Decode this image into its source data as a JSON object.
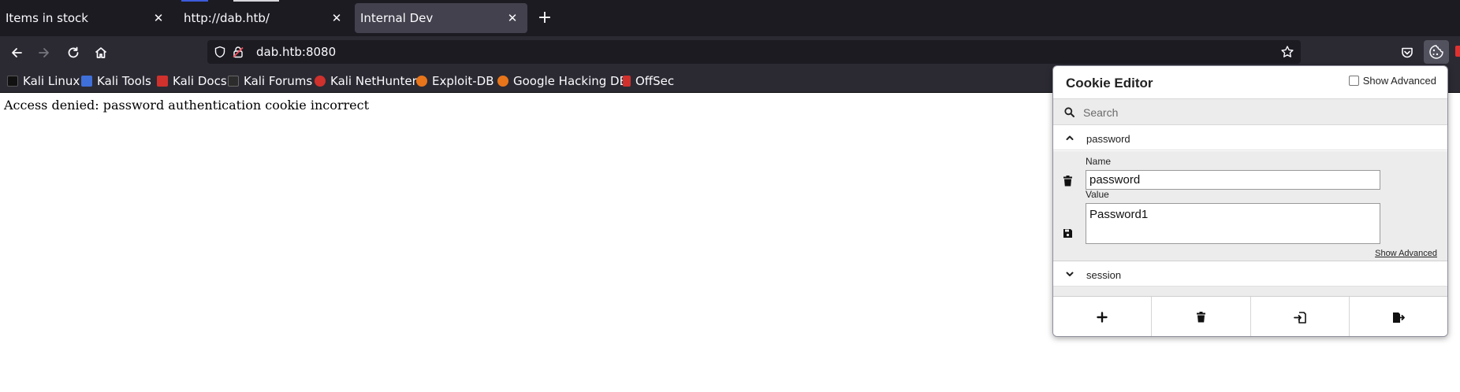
{
  "tabs": [
    {
      "title": "Items in stock",
      "active": false
    },
    {
      "title": "http://dab.htb/",
      "active": false
    },
    {
      "title": "Internal Dev",
      "active": true
    }
  ],
  "navbar": {
    "url": "dab.htb:8080"
  },
  "bookmarks": [
    {
      "label": "Kali Linux",
      "icon": "kali-linux-icon",
      "color": "#2c2c2c"
    },
    {
      "label": "Kali Tools",
      "icon": "kali-tools-icon",
      "color": "#3f6fd8"
    },
    {
      "label": "Kali Docs",
      "icon": "kali-docs-icon",
      "color": "#d0312d"
    },
    {
      "label": "Kali Forums",
      "icon": "kali-forums-icon",
      "color": "#2c2c2c"
    },
    {
      "label": "Kali NetHunter",
      "icon": "kali-nethunter-icon",
      "color": "#d0312d"
    },
    {
      "label": "Exploit-DB",
      "icon": "exploit-db-icon",
      "color": "#e8751a"
    },
    {
      "label": "Google Hacking DB",
      "icon": "google-hacking-db-icon",
      "color": "#e8751a"
    },
    {
      "label": "OffSec",
      "icon": "offsec-icon",
      "color": "#d0312d"
    }
  ],
  "page": {
    "message": "Access denied: password authentication cookie incorrect"
  },
  "cookie_editor": {
    "title": "Cookie Editor",
    "show_advanced_label": "Show Advanced",
    "show_advanced_checked": false,
    "search_placeholder": "Search",
    "expanded_cookie": {
      "header": "password",
      "name_label": "Name",
      "name_value": "password",
      "value_label": "Value",
      "value_value": "Password1",
      "show_advanced_link": "Show Advanced"
    },
    "collapsed_cookie": {
      "header": "session"
    }
  },
  "colors": {
    "tabstrip_bg": "#1c1b22",
    "toolbar_bg": "#2b2a33",
    "active_tab_bg": "#42414d",
    "panel_bg": "#ececec"
  }
}
